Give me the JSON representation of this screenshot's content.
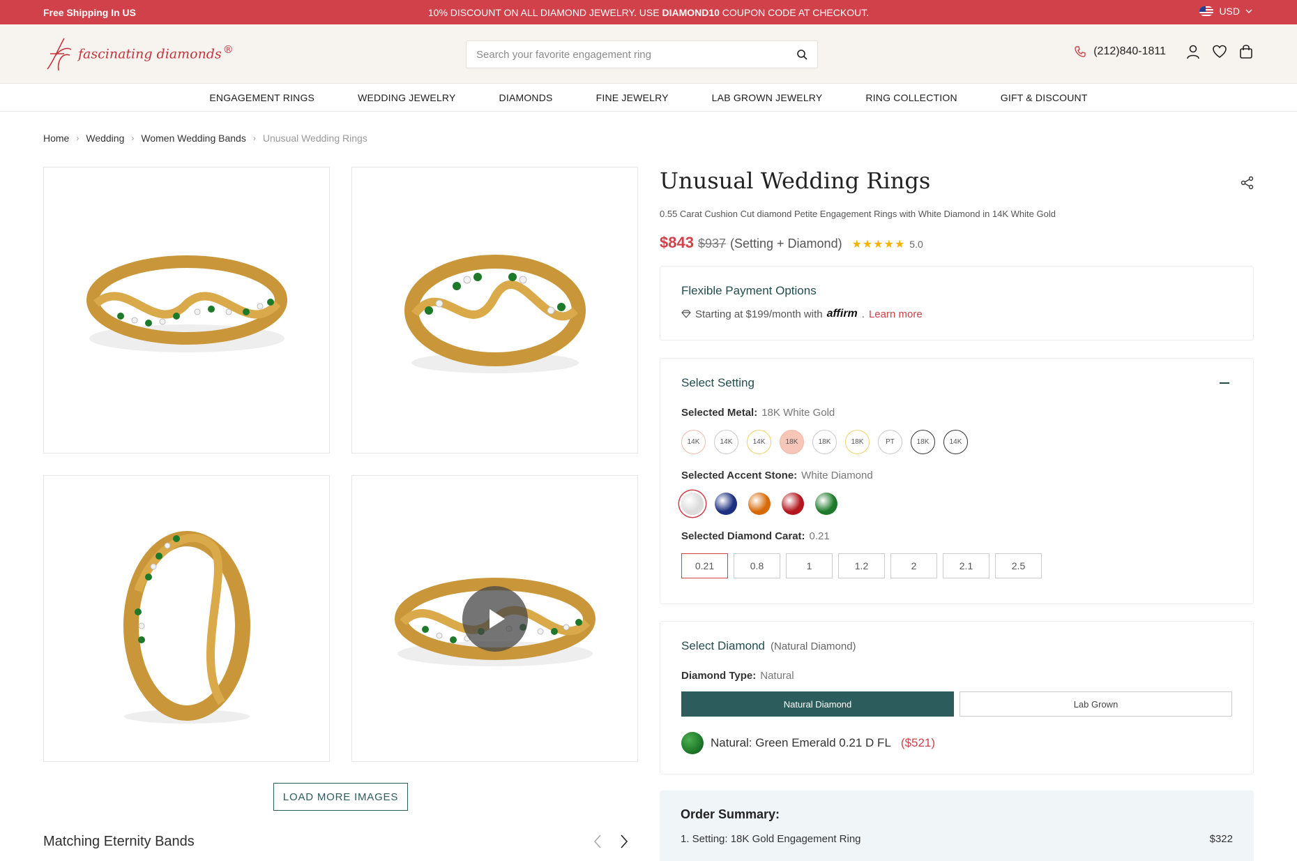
{
  "topbar": {
    "left": "Free Shipping In US",
    "promo_pre": "10% DISCOUNT ON ALL DIAMOND JEWELRY. USE ",
    "promo_code": "DIAMOND10",
    "promo_post": " COUPON CODE AT CHECKOUT.",
    "currency": "USD"
  },
  "header": {
    "logo_text": "fascinating diamonds",
    "logo_reg": "®",
    "search_placeholder": "Search your favorite engagement ring",
    "phone": "(212)840-1811"
  },
  "nav": [
    "ENGAGEMENT RINGS",
    "WEDDING JEWELRY",
    "DIAMONDS",
    "FINE JEWELRY",
    "LAB GROWN JEWELRY",
    "RING COLLECTION",
    "GIFT & DISCOUNT"
  ],
  "breadcrumb": [
    "Home",
    "Wedding",
    "Women Wedding Bands",
    "Unusual Wedding Rings"
  ],
  "gallery": {
    "load_more": "LOAD MORE IMAGES",
    "matching_title": "Matching Eternity Bands"
  },
  "product": {
    "title": "Unusual Wedding Rings",
    "subtitle": "0.55 Carat Cushion Cut diamond Petite Engagement Rings with White Diamond in 14K White Gold",
    "price": "$843",
    "old_price": "$937",
    "price_note": "(Setting + Diamond)",
    "stars": "★★★★★",
    "rating": "5.0"
  },
  "payment": {
    "title": "Flexible Payment Options",
    "starting": "Starting at $199/month with",
    "affirm": "affirm",
    "learn_more": "Learn more"
  },
  "setting": {
    "title": "Select Setting",
    "metal_label": "Selected Metal:",
    "metal_value": "18K White Gold",
    "metals": [
      {
        "label": "14K",
        "color": "#f2b8a8",
        "bg": "#ffffff"
      },
      {
        "label": "14K",
        "color": "#c9c9c9",
        "bg": "#ffffff"
      },
      {
        "label": "14K",
        "color": "#f2d06a",
        "bg": "#ffffff"
      },
      {
        "label": "18K",
        "color": "#f2b8a8",
        "bg": "#f6c6b8"
      },
      {
        "label": "18K",
        "color": "#c9c9c9",
        "bg": "#ffffff"
      },
      {
        "label": "18K",
        "color": "#f2d06a",
        "bg": "#ffffff"
      },
      {
        "label": "PT",
        "color": "#c9c9c9",
        "bg": "#ffffff"
      },
      {
        "label": "18K",
        "color": "#333333",
        "bg": "#ffffff"
      },
      {
        "label": "14K",
        "color": "#333333",
        "bg": "#ffffff"
      }
    ],
    "accent_label": "Selected Accent Stone:",
    "accent_value": "White Diamond",
    "stones": [
      {
        "name": "white-diamond",
        "color": "#dcdcdc"
      },
      {
        "name": "blue-sapphire",
        "color": "#1c2f80"
      },
      {
        "name": "orange-sapphire",
        "color": "#d76a08"
      },
      {
        "name": "ruby",
        "color": "#b3161e"
      },
      {
        "name": "emerald",
        "color": "#1e7a2a"
      }
    ],
    "carat_label": "Selected Diamond Carat:",
    "carat_value": "0.21",
    "carats": [
      "0.21",
      "0.8",
      "1",
      "1.2",
      "2",
      "2.1",
      "2.5"
    ]
  },
  "diamond": {
    "title": "Select Diamond",
    "title_note": "(Natural Diamond)",
    "type_label": "Diamond Type:",
    "type_value": "Natural",
    "types": [
      "Natural Diamond",
      "Lab Grown"
    ],
    "gem_text": "Natural: Green Emerald 0.21 D FL",
    "gem_price": "($521)"
  },
  "summary": {
    "title": "Order Summary:",
    "line1_label": "1. Setting: 18K Gold Engagement Ring",
    "line1_price": "$322"
  },
  "colors": {
    "accent": "#d0414a",
    "teal": "#2c5c5c",
    "gold": "#d9a94a",
    "emerald": "#1e7a2a"
  }
}
